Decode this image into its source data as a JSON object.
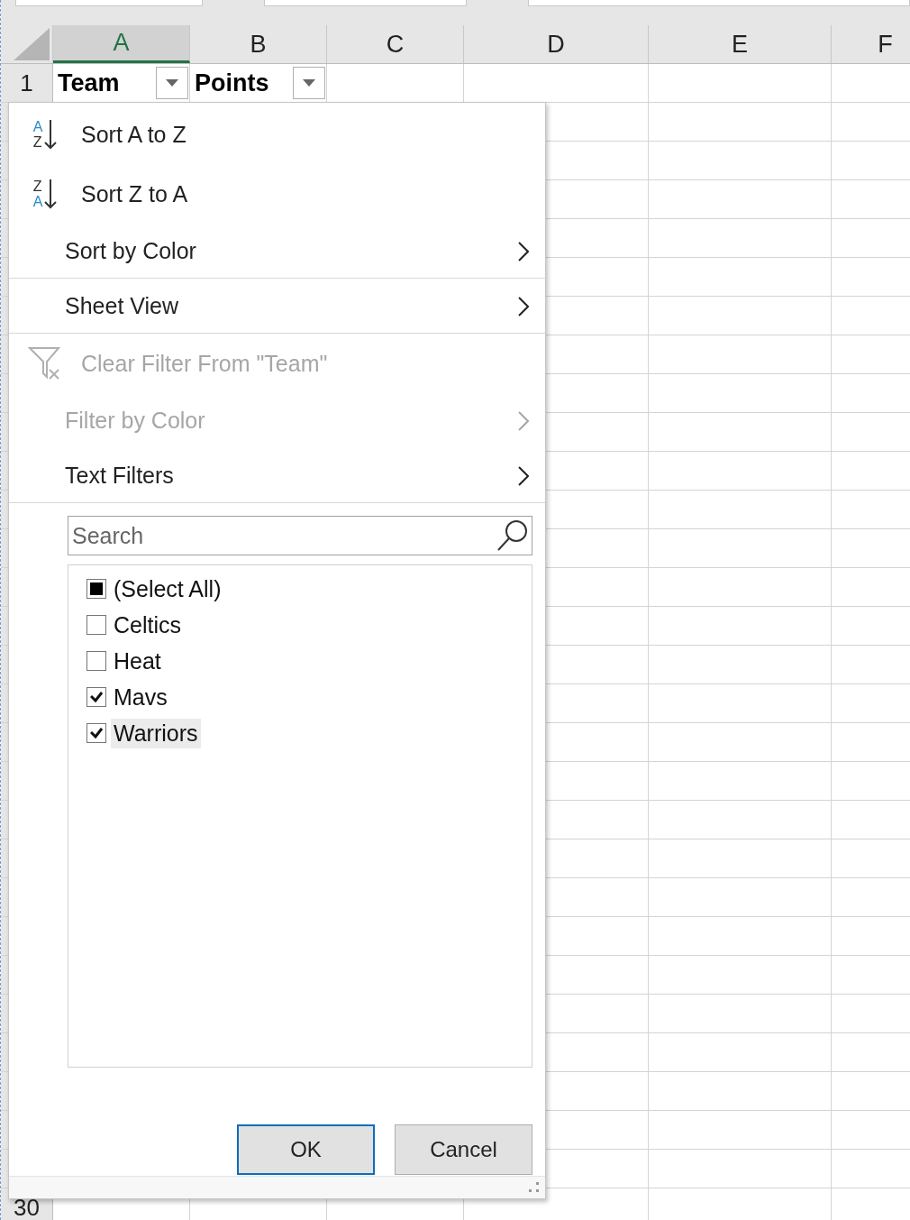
{
  "sheet": {
    "columns": [
      {
        "label": "A",
        "selected": true
      },
      {
        "label": "B",
        "selected": false
      },
      {
        "label": "C",
        "selected": false
      },
      {
        "label": "D",
        "selected": false
      },
      {
        "label": "E",
        "selected": false
      },
      {
        "label": "F",
        "selected": false
      }
    ],
    "rows": [
      {
        "number": "1",
        "cells": [
          {
            "text": "Team",
            "filter": true
          },
          {
            "text": "Points",
            "filter": true
          }
        ]
      },
      {
        "number": "30",
        "cells": []
      }
    ]
  },
  "filter_menu": {
    "items": [
      {
        "kind": "sort",
        "icon_letters": [
          "A",
          "Z"
        ],
        "label": "Sort A to Z",
        "disabled": false,
        "submenu": false,
        "separator_after": false
      },
      {
        "kind": "sort",
        "icon_letters": [
          "Z",
          "A"
        ],
        "label": "Sort Z to A",
        "disabled": false,
        "submenu": false,
        "separator_after": false
      },
      {
        "kind": "plain",
        "label": "Sort by Color",
        "disabled": false,
        "submenu": true,
        "separator_after": true
      },
      {
        "kind": "plain",
        "label": "Sheet View",
        "disabled": false,
        "submenu": true,
        "separator_after": true
      },
      {
        "kind": "clear_filter",
        "label": "Clear Filter From \"Team\"",
        "disabled": true,
        "submenu": false,
        "separator_after": false
      },
      {
        "kind": "plain",
        "label": "Filter by Color",
        "disabled": true,
        "submenu": true,
        "separator_after": false
      },
      {
        "kind": "plain",
        "label": "Text Filters",
        "disabled": false,
        "submenu": true,
        "separator_after": true
      }
    ],
    "search": {
      "placeholder": "Search"
    },
    "values": [
      {
        "label": "(Select All)",
        "checked": false,
        "indeterminate": true,
        "selected": false
      },
      {
        "label": "Celtics",
        "checked": false,
        "selected": false
      },
      {
        "label": "Heat",
        "checked": false,
        "selected": false
      },
      {
        "label": "Mavs",
        "checked": true,
        "selected": false
      },
      {
        "label": "Warriors",
        "checked": true,
        "selected": true
      }
    ],
    "buttons": [
      {
        "label": "OK",
        "default": true
      },
      {
        "label": "Cancel",
        "default": false
      }
    ]
  }
}
